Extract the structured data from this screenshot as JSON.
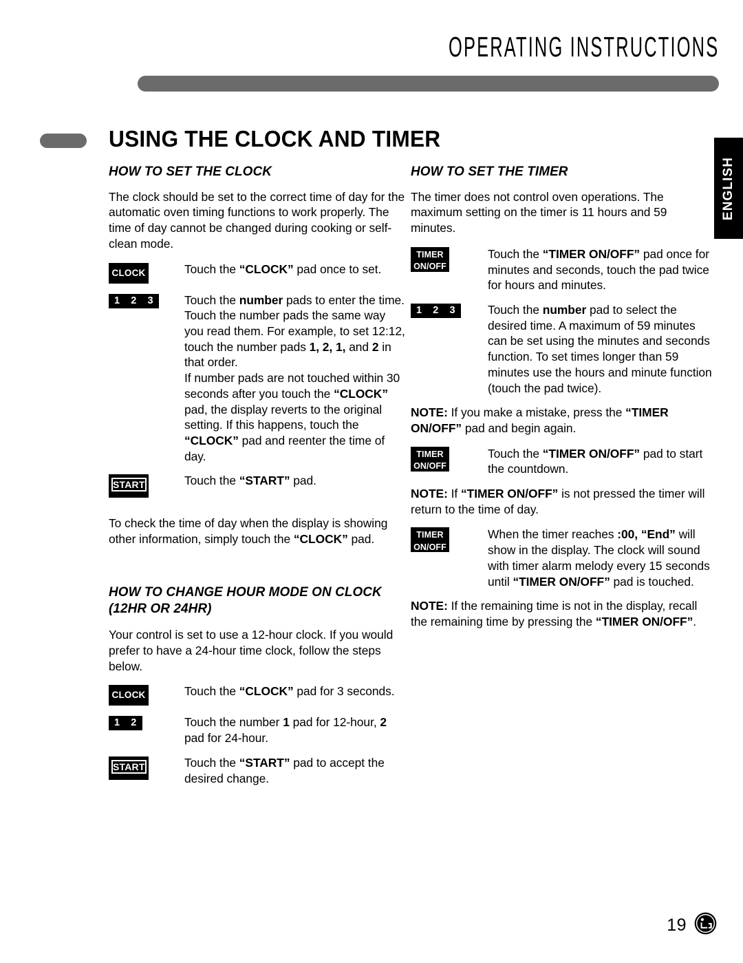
{
  "header": {
    "title": "OPERATING INSTRUCTIONS"
  },
  "side_tab": {
    "label": "ENGLISH"
  },
  "page_title": "USING THE CLOCK AND TIMER",
  "left_column": {
    "section1": {
      "heading": "HOW TO SET THE CLOCK",
      "intro": "The clock should be set to the correct time of day for the automatic oven timing functions to work properly. The time of day cannot be changed during cooking or self-clean mode.",
      "steps": [
        {
          "icon": "clock-pad-icon",
          "pad_label": "CLOCK",
          "text_html": "Touch the <b>“CLOCK”</b> pad once to set."
        },
        {
          "icon": "number-pad-123-icon",
          "pad_digits": [
            "1",
            "2",
            "3"
          ],
          "text_html": "Touch the <b>number</b> pads to enter the time. Touch the number pads the same way you read them. For example, to set 12:12, touch the number pads <b>1, 2, 1,</b> and <b>2</b> in that order.<br>If number pads are not touched within 30 seconds after you touch the <b>“CLOCK”</b> pad, the display reverts to the original setting. If this happens, touch the <b>“CLOCK”</b> pad and reenter the time of day."
        },
        {
          "icon": "start-pad-icon",
          "pad_label": "START",
          "text_html": "Touch the <b>“START”</b> pad."
        }
      ],
      "closing": "To check the time of day when the display is showing other information, simply touch the “CLOCK” pad.",
      "closing_html": "To check the time of day when the display is showing other information, simply touch the <b>“CLOCK”</b> pad."
    },
    "section2": {
      "heading": "HOW TO CHANGE HOUR MODE ON CLOCK (12HR OR 24HR)",
      "heading_line1": "HOW TO CHANGE HOUR MODE ON CLOCK",
      "heading_line2": "(12HR OR 24HR)",
      "intro": "Your control is set to use a 12-hour clock. If you would prefer to have a 24-hour time clock, follow the steps below.",
      "steps": [
        {
          "icon": "clock-pad-icon",
          "pad_label": "CLOCK",
          "text_html": "Touch the <b>“CLOCK”</b> pad for 3 seconds."
        },
        {
          "icon": "number-pad-12-icon",
          "pad_digits": [
            "1",
            "2"
          ],
          "text_html": "Touch the number <b>1</b> pad for 12-hour, <b>2</b> pad for 24-hour."
        },
        {
          "icon": "start-pad-icon",
          "pad_label": "START",
          "text_html": "Touch the <b>“START”</b> pad to accept the desired change."
        }
      ]
    }
  },
  "right_column": {
    "section1": {
      "heading": "HOW TO SET THE TIMER",
      "intro": "The timer does not control oven operations. The maximum setting on the timer is 11 hours and 59 minutes.",
      "steps": [
        {
          "icon": "timer-onoff-pad-icon",
          "pad_line1": "TIMER",
          "pad_line2": "ON/OFF",
          "text_html": "Touch the <b>“TIMER ON/OFF”</b> pad once for minutes and seconds, touch the pad twice for hours and minutes."
        },
        {
          "icon": "number-pad-123-icon",
          "pad_digits": [
            "1",
            "2",
            "3"
          ],
          "text_html": "Touch the <b>number</b> pad to select the desired time. A maximum of 59 minutes can be set using the minutes and seconds function. To set times longer than 59 minutes use the hours and minute function (touch the pad twice)."
        }
      ],
      "note1_html": "<b>NOTE:</b> If you make a mistake, press the <b>“TIMER ON/OFF”</b> pad and begin again.",
      "step3": {
        "icon": "timer-onoff-pad-icon",
        "pad_line1": "TIMER",
        "pad_line2": "ON/OFF",
        "text_html": "Touch the <b>“TIMER ON/OFF”</b> pad to start the countdown."
      },
      "note2_html": "<b>NOTE:</b> If <b>“TIMER ON/OFF”</b> is not pressed the timer will return to the time of day.",
      "step4": {
        "icon": "timer-onoff-pad-icon",
        "pad_line1": "TIMER",
        "pad_line2": "ON/OFF",
        "text_html": "When the timer reaches <b>:00, “End”</b> will show in the display. The clock will sound with timer alarm melody every 15 seconds until <b>“TIMER ON/OFF”</b> pad is touched."
      },
      "note3_html": "<b>NOTE:</b> If the remaining time is not in the display, recall the remaining time by pressing the <b>“TIMER ON/OFF”</b>."
    }
  },
  "footer": {
    "page_number": "19",
    "logo": "lg-logo"
  },
  "colors": {
    "accent_gray": "#6b6b6b",
    "ink": "#000000",
    "paper": "#ffffff"
  }
}
